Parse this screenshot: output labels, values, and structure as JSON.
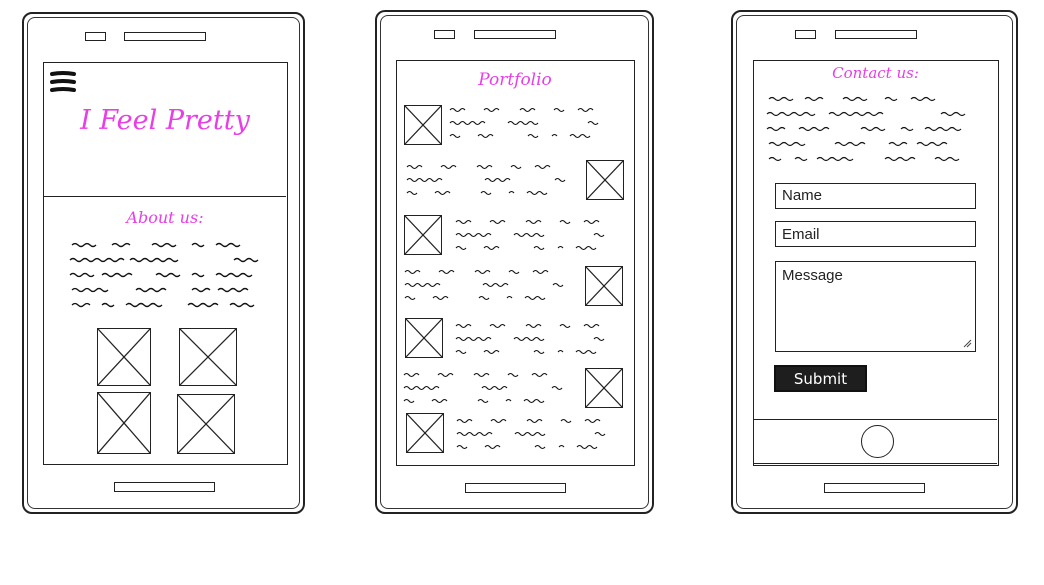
{
  "phone1": {
    "hero_title": "I Feel Pretty",
    "menu_icon": "hamburger-menu-icon",
    "section_title": "About us:"
  },
  "phone2": {
    "section_title": "Portfolio"
  },
  "phone3": {
    "section_title": "Contact us:",
    "form": {
      "name_placeholder": "Name",
      "email_placeholder": "Email",
      "message_placeholder": "Message",
      "submit_label": "Submit"
    },
    "home_button_icon": "home-button-icon"
  },
  "colors": {
    "accent": "#e83ee8",
    "ink": "#222222",
    "button_bg": "#1e1e1e"
  }
}
